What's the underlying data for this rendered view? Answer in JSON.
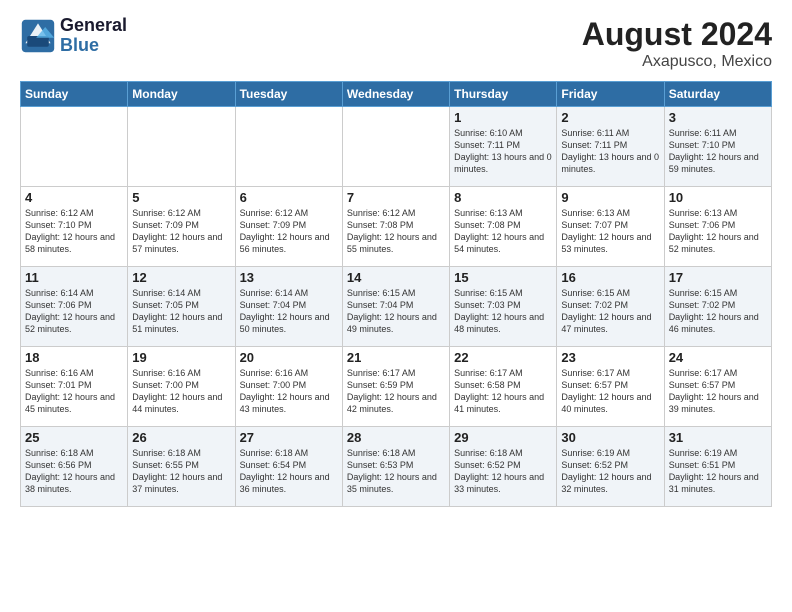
{
  "logo": {
    "line1": "General",
    "line2": "Blue"
  },
  "title": "August 2024",
  "subtitle": "Axapusco, Mexico",
  "days_of_week": [
    "Sunday",
    "Monday",
    "Tuesday",
    "Wednesday",
    "Thursday",
    "Friday",
    "Saturday"
  ],
  "weeks": [
    [
      {
        "day": "",
        "text": ""
      },
      {
        "day": "",
        "text": ""
      },
      {
        "day": "",
        "text": ""
      },
      {
        "day": "",
        "text": ""
      },
      {
        "day": "1",
        "text": "Sunrise: 6:10 AM\nSunset: 7:11 PM\nDaylight: 13 hours and 0 minutes."
      },
      {
        "day": "2",
        "text": "Sunrise: 6:11 AM\nSunset: 7:11 PM\nDaylight: 13 hours and 0 minutes."
      },
      {
        "day": "3",
        "text": "Sunrise: 6:11 AM\nSunset: 7:10 PM\nDaylight: 12 hours and 59 minutes."
      }
    ],
    [
      {
        "day": "4",
        "text": "Sunrise: 6:12 AM\nSunset: 7:10 PM\nDaylight: 12 hours and 58 minutes."
      },
      {
        "day": "5",
        "text": "Sunrise: 6:12 AM\nSunset: 7:09 PM\nDaylight: 12 hours and 57 minutes."
      },
      {
        "day": "6",
        "text": "Sunrise: 6:12 AM\nSunset: 7:09 PM\nDaylight: 12 hours and 56 minutes."
      },
      {
        "day": "7",
        "text": "Sunrise: 6:12 AM\nSunset: 7:08 PM\nDaylight: 12 hours and 55 minutes."
      },
      {
        "day": "8",
        "text": "Sunrise: 6:13 AM\nSunset: 7:08 PM\nDaylight: 12 hours and 54 minutes."
      },
      {
        "day": "9",
        "text": "Sunrise: 6:13 AM\nSunset: 7:07 PM\nDaylight: 12 hours and 53 minutes."
      },
      {
        "day": "10",
        "text": "Sunrise: 6:13 AM\nSunset: 7:06 PM\nDaylight: 12 hours and 52 minutes."
      }
    ],
    [
      {
        "day": "11",
        "text": "Sunrise: 6:14 AM\nSunset: 7:06 PM\nDaylight: 12 hours and 52 minutes."
      },
      {
        "day": "12",
        "text": "Sunrise: 6:14 AM\nSunset: 7:05 PM\nDaylight: 12 hours and 51 minutes."
      },
      {
        "day": "13",
        "text": "Sunrise: 6:14 AM\nSunset: 7:04 PM\nDaylight: 12 hours and 50 minutes."
      },
      {
        "day": "14",
        "text": "Sunrise: 6:15 AM\nSunset: 7:04 PM\nDaylight: 12 hours and 49 minutes."
      },
      {
        "day": "15",
        "text": "Sunrise: 6:15 AM\nSunset: 7:03 PM\nDaylight: 12 hours and 48 minutes."
      },
      {
        "day": "16",
        "text": "Sunrise: 6:15 AM\nSunset: 7:02 PM\nDaylight: 12 hours and 47 minutes."
      },
      {
        "day": "17",
        "text": "Sunrise: 6:15 AM\nSunset: 7:02 PM\nDaylight: 12 hours and 46 minutes."
      }
    ],
    [
      {
        "day": "18",
        "text": "Sunrise: 6:16 AM\nSunset: 7:01 PM\nDaylight: 12 hours and 45 minutes."
      },
      {
        "day": "19",
        "text": "Sunrise: 6:16 AM\nSunset: 7:00 PM\nDaylight: 12 hours and 44 minutes."
      },
      {
        "day": "20",
        "text": "Sunrise: 6:16 AM\nSunset: 7:00 PM\nDaylight: 12 hours and 43 minutes."
      },
      {
        "day": "21",
        "text": "Sunrise: 6:17 AM\nSunset: 6:59 PM\nDaylight: 12 hours and 42 minutes."
      },
      {
        "day": "22",
        "text": "Sunrise: 6:17 AM\nSunset: 6:58 PM\nDaylight: 12 hours and 41 minutes."
      },
      {
        "day": "23",
        "text": "Sunrise: 6:17 AM\nSunset: 6:57 PM\nDaylight: 12 hours and 40 minutes."
      },
      {
        "day": "24",
        "text": "Sunrise: 6:17 AM\nSunset: 6:57 PM\nDaylight: 12 hours and 39 minutes."
      }
    ],
    [
      {
        "day": "25",
        "text": "Sunrise: 6:18 AM\nSunset: 6:56 PM\nDaylight: 12 hours and 38 minutes."
      },
      {
        "day": "26",
        "text": "Sunrise: 6:18 AM\nSunset: 6:55 PM\nDaylight: 12 hours and 37 minutes."
      },
      {
        "day": "27",
        "text": "Sunrise: 6:18 AM\nSunset: 6:54 PM\nDaylight: 12 hours and 36 minutes."
      },
      {
        "day": "28",
        "text": "Sunrise: 6:18 AM\nSunset: 6:53 PM\nDaylight: 12 hours and 35 minutes."
      },
      {
        "day": "29",
        "text": "Sunrise: 6:18 AM\nSunset: 6:52 PM\nDaylight: 12 hours and 33 minutes."
      },
      {
        "day": "30",
        "text": "Sunrise: 6:19 AM\nSunset: 6:52 PM\nDaylight: 12 hours and 32 minutes."
      },
      {
        "day": "31",
        "text": "Sunrise: 6:19 AM\nSunset: 6:51 PM\nDaylight: 12 hours and 31 minutes."
      }
    ]
  ]
}
